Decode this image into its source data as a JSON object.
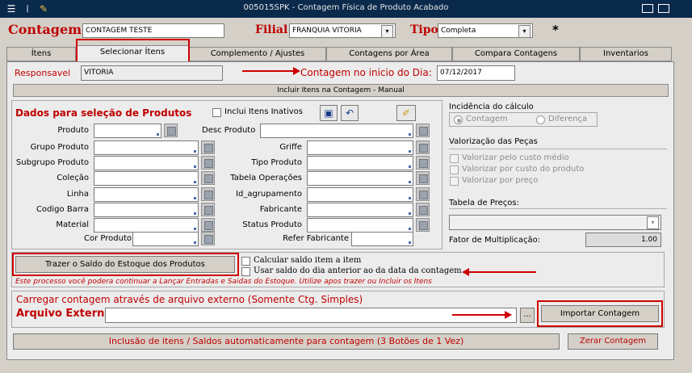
{
  "window": {
    "title": "005015SPK - Contagem Física de Produto Acabado"
  },
  "header": {
    "contagem_label": "Contagem",
    "contagem_value": "CONTAGEM TESTE",
    "filial_label": "Filial",
    "filial_value": "FRANQUIA VITORIA",
    "tipo_label": "Tipo",
    "tipo_value": "Completa",
    "asterisk": "*"
  },
  "tabs": [
    {
      "label": "Ítens"
    },
    {
      "label": "Selecionar Ítens"
    },
    {
      "label": "Complemento / Ajustes"
    },
    {
      "label": "Contagens por Área"
    },
    {
      "label": "Compara Contagens"
    },
    {
      "label": "Inventarios"
    }
  ],
  "responsavel": {
    "label": "Responsavel",
    "value": "VITORIA"
  },
  "contagem_dia": {
    "label": "Contagem no inicio do Dia:",
    "value": "07/12/2017"
  },
  "incluir_header": "Incluir Itens na Contagem - Manual",
  "selecao": {
    "title": "Dados para seleção de Produtos",
    "inativos_label": "Inclui Itens Inativos",
    "left_fields": [
      {
        "label": "Produto"
      },
      {
        "label": "Grupo Produto"
      },
      {
        "label": "Subgrupo Produto"
      },
      {
        "label": "Coleção"
      },
      {
        "label": "Linha"
      },
      {
        "label": "Codigo Barra"
      },
      {
        "label": "Material"
      },
      {
        "label": "Cor Produto"
      }
    ],
    "right_fields": [
      {
        "label": "Desc Produto"
      },
      {
        "label": "Griffe"
      },
      {
        "label": "Tipo Produto"
      },
      {
        "label": "Tabela Operações"
      },
      {
        "label": "Id_agrupamento"
      },
      {
        "label": "Fabricante"
      },
      {
        "label": "Status Produto"
      },
      {
        "label": "Refer Fabricante"
      }
    ]
  },
  "incidencia": {
    "title": "Incidência do cálculo",
    "opt1": "Contagem",
    "opt2": "Diferença"
  },
  "valorizacao": {
    "title": "Valorização das Peças",
    "opts": [
      "Valorizar pelo custo médio",
      "Valorizar por custo do produto",
      "Valorizar por preço"
    ]
  },
  "tabela_precos": {
    "title": "Tabela de Preços:"
  },
  "fator": {
    "label": "Fator de Multiplicação:",
    "value": "1.00"
  },
  "saldo": {
    "button": "Trazer o Saldo do Estoque dos Produtos",
    "chk1": "Calcular saldo item a item",
    "chk2": "Usar saldo do dia anterior ao da data da contagem",
    "note": "Este processo você podera continuar a Lançar Entradas e Saidas do Estoque. Utilize apos trazer ou Incluir os Itens"
  },
  "arquivo": {
    "title": "Carregar contagem através de arquivo externo (Somente Ctg. Simples)",
    "label": "Arquivo Externo",
    "value": "",
    "browse": "...",
    "import_button": "Importar Contagem"
  },
  "footer": {
    "auto_button": "Inclusão de itens / Saldos automaticamente para contagem (3 Botões de 1 Vez)",
    "zerar_button": "Zerar Contagem"
  },
  "colors": {
    "accent_red": "#c00000",
    "title_bar": "#0a2a4c"
  }
}
